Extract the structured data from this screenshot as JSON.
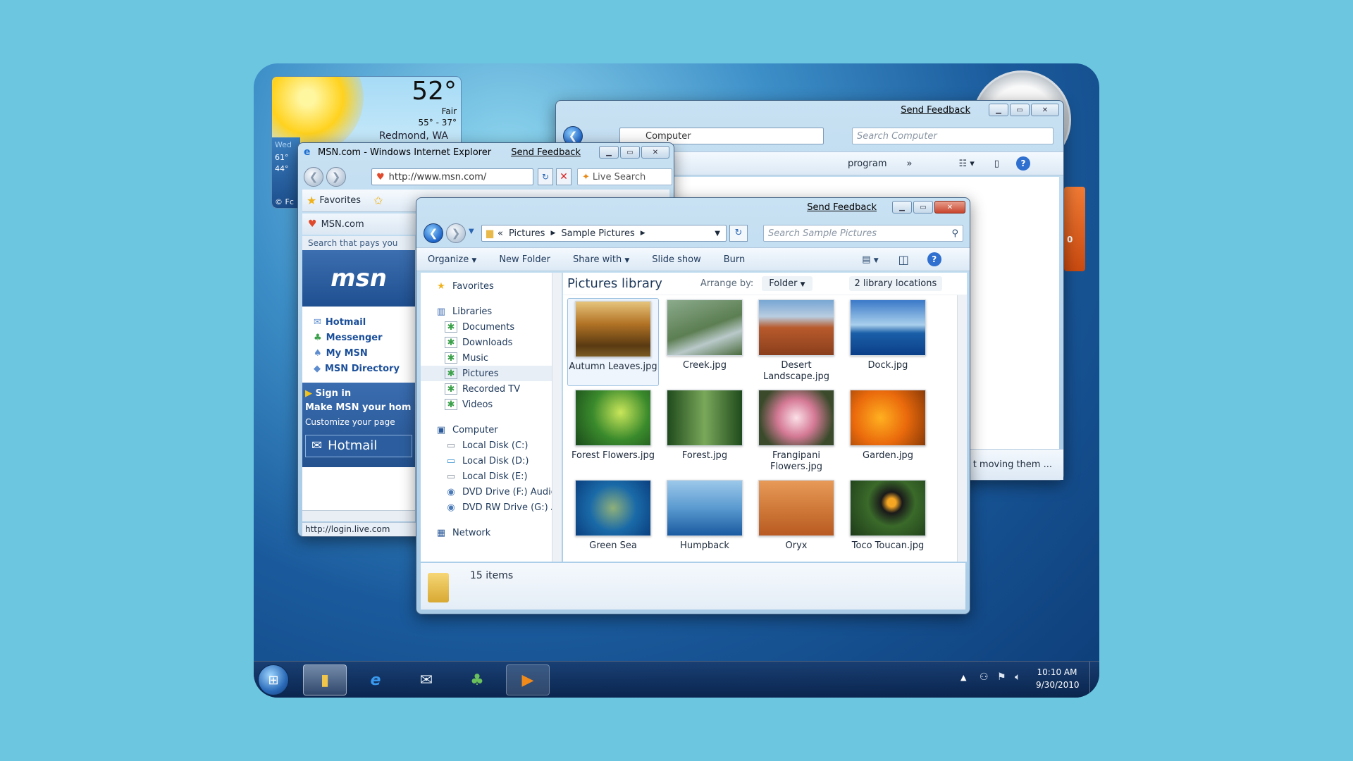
{
  "weather": {
    "temp": "52°",
    "cond": "Fair",
    "range": "55° - 37°",
    "city": "Redmond, WA",
    "day": "Wed",
    "hi": "61°",
    "lo": "44°",
    "fc": "© Fc"
  },
  "back_window": {
    "feedback": "Send Feedback",
    "address": "Computer",
    "search_placeholder": "Search Computer",
    "toolbar_text": "program",
    "more": "»",
    "status": "t moving them ..."
  },
  "ie": {
    "title": "MSN.com - Windows Internet Explorer",
    "feedback": "Send Feedback",
    "url": "http://www.msn.com/",
    "search": "Live Search",
    "favorites": "Favorites",
    "tab": "MSN.com",
    "search_bar": "Search that pays you",
    "logo": "msn",
    "links": [
      "Hotmail",
      "Messenger",
      "My MSN",
      "MSN Directory"
    ],
    "sign_in": "Sign in",
    "make": "Make MSN your hom",
    "customize": "Customize your page",
    "hotmail_button": "Hotmail",
    "status_url": "http://login.live.com"
  },
  "explorer": {
    "feedback": "Send Feedback",
    "crumb_prefix": "«",
    "crumb1": "Pictures",
    "crumb2": "Sample Pictures",
    "search_placeholder": "Search Sample Pictures",
    "toolbar": {
      "organize": "Organize",
      "new_folder": "New Folder",
      "share": "Share with",
      "slideshow": "Slide show",
      "burn": "Burn"
    },
    "library_title": "Pictures library",
    "arrange_label": "Arrange by:",
    "arrange_value": "Folder",
    "locations": "2 library locations",
    "nav": {
      "favorites": "Favorites",
      "libraries": "Libraries",
      "lib_items": [
        "Documents",
        "Downloads",
        "Music",
        "Pictures",
        "Recorded TV",
        "Videos"
      ],
      "computer": "Computer",
      "drives": [
        "Local Disk (C:)",
        "Local Disk (D:)",
        "Local Disk (E:)",
        "DVD Drive (F:) Audio",
        "DVD RW Drive (G:) A"
      ],
      "network": "Network"
    },
    "files": [
      "Autumn Leaves.jpg",
      "Creek.jpg",
      "Desert Landscape.jpg",
      "Dock.jpg",
      "Forest Flowers.jpg",
      "Forest.jpg",
      "Frangipani Flowers.jpg",
      "Garden.jpg",
      "Green Sea",
      "Humpback",
      "Oryx",
      "Toco Toucan.jpg"
    ],
    "items": "15 items"
  },
  "clock_gadget": {
    "label": "0"
  },
  "taskbar": {
    "time": "10:10 AM",
    "date": "9/30/2010",
    "icons": [
      "windows-start-icon",
      "explorer-folder-icon",
      "internet-explorer-icon",
      "mail-icon",
      "messenger-icon",
      "media-player-icon"
    ]
  },
  "colors": {
    "accent": "#1e64c8",
    "background": "#6cc6e0",
    "taskbar": "#0d3d78"
  }
}
